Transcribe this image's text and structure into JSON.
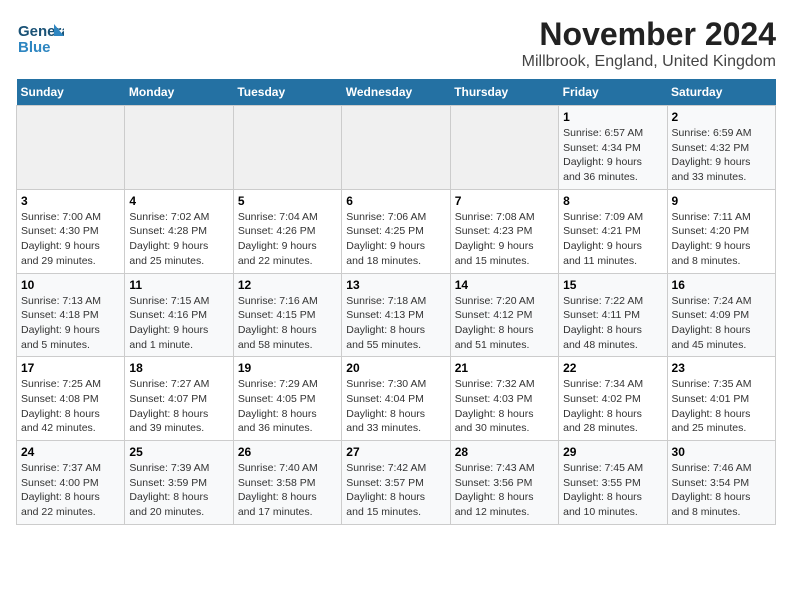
{
  "header": {
    "logo_general": "General",
    "logo_blue": "Blue",
    "title": "November 2024",
    "subtitle": "Millbrook, England, United Kingdom"
  },
  "days_of_week": [
    "Sunday",
    "Monday",
    "Tuesday",
    "Wednesday",
    "Thursday",
    "Friday",
    "Saturday"
  ],
  "weeks": [
    [
      {
        "day": "",
        "info": ""
      },
      {
        "day": "",
        "info": ""
      },
      {
        "day": "",
        "info": ""
      },
      {
        "day": "",
        "info": ""
      },
      {
        "day": "",
        "info": ""
      },
      {
        "day": "1",
        "info": "Sunrise: 6:57 AM\nSunset: 4:34 PM\nDaylight: 9 hours\nand 36 minutes."
      },
      {
        "day": "2",
        "info": "Sunrise: 6:59 AM\nSunset: 4:32 PM\nDaylight: 9 hours\nand 33 minutes."
      }
    ],
    [
      {
        "day": "3",
        "info": "Sunrise: 7:00 AM\nSunset: 4:30 PM\nDaylight: 9 hours\nand 29 minutes."
      },
      {
        "day": "4",
        "info": "Sunrise: 7:02 AM\nSunset: 4:28 PM\nDaylight: 9 hours\nand 25 minutes."
      },
      {
        "day": "5",
        "info": "Sunrise: 7:04 AM\nSunset: 4:26 PM\nDaylight: 9 hours\nand 22 minutes."
      },
      {
        "day": "6",
        "info": "Sunrise: 7:06 AM\nSunset: 4:25 PM\nDaylight: 9 hours\nand 18 minutes."
      },
      {
        "day": "7",
        "info": "Sunrise: 7:08 AM\nSunset: 4:23 PM\nDaylight: 9 hours\nand 15 minutes."
      },
      {
        "day": "8",
        "info": "Sunrise: 7:09 AM\nSunset: 4:21 PM\nDaylight: 9 hours\nand 11 minutes."
      },
      {
        "day": "9",
        "info": "Sunrise: 7:11 AM\nSunset: 4:20 PM\nDaylight: 9 hours\nand 8 minutes."
      }
    ],
    [
      {
        "day": "10",
        "info": "Sunrise: 7:13 AM\nSunset: 4:18 PM\nDaylight: 9 hours\nand 5 minutes."
      },
      {
        "day": "11",
        "info": "Sunrise: 7:15 AM\nSunset: 4:16 PM\nDaylight: 9 hours\nand 1 minute."
      },
      {
        "day": "12",
        "info": "Sunrise: 7:16 AM\nSunset: 4:15 PM\nDaylight: 8 hours\nand 58 minutes."
      },
      {
        "day": "13",
        "info": "Sunrise: 7:18 AM\nSunset: 4:13 PM\nDaylight: 8 hours\nand 55 minutes."
      },
      {
        "day": "14",
        "info": "Sunrise: 7:20 AM\nSunset: 4:12 PM\nDaylight: 8 hours\nand 51 minutes."
      },
      {
        "day": "15",
        "info": "Sunrise: 7:22 AM\nSunset: 4:11 PM\nDaylight: 8 hours\nand 48 minutes."
      },
      {
        "day": "16",
        "info": "Sunrise: 7:24 AM\nSunset: 4:09 PM\nDaylight: 8 hours\nand 45 minutes."
      }
    ],
    [
      {
        "day": "17",
        "info": "Sunrise: 7:25 AM\nSunset: 4:08 PM\nDaylight: 8 hours\nand 42 minutes."
      },
      {
        "day": "18",
        "info": "Sunrise: 7:27 AM\nSunset: 4:07 PM\nDaylight: 8 hours\nand 39 minutes."
      },
      {
        "day": "19",
        "info": "Sunrise: 7:29 AM\nSunset: 4:05 PM\nDaylight: 8 hours\nand 36 minutes."
      },
      {
        "day": "20",
        "info": "Sunrise: 7:30 AM\nSunset: 4:04 PM\nDaylight: 8 hours\nand 33 minutes."
      },
      {
        "day": "21",
        "info": "Sunrise: 7:32 AM\nSunset: 4:03 PM\nDaylight: 8 hours\nand 30 minutes."
      },
      {
        "day": "22",
        "info": "Sunrise: 7:34 AM\nSunset: 4:02 PM\nDaylight: 8 hours\nand 28 minutes."
      },
      {
        "day": "23",
        "info": "Sunrise: 7:35 AM\nSunset: 4:01 PM\nDaylight: 8 hours\nand 25 minutes."
      }
    ],
    [
      {
        "day": "24",
        "info": "Sunrise: 7:37 AM\nSunset: 4:00 PM\nDaylight: 8 hours\nand 22 minutes."
      },
      {
        "day": "25",
        "info": "Sunrise: 7:39 AM\nSunset: 3:59 PM\nDaylight: 8 hours\nand 20 minutes."
      },
      {
        "day": "26",
        "info": "Sunrise: 7:40 AM\nSunset: 3:58 PM\nDaylight: 8 hours\nand 17 minutes."
      },
      {
        "day": "27",
        "info": "Sunrise: 7:42 AM\nSunset: 3:57 PM\nDaylight: 8 hours\nand 15 minutes."
      },
      {
        "day": "28",
        "info": "Sunrise: 7:43 AM\nSunset: 3:56 PM\nDaylight: 8 hours\nand 12 minutes."
      },
      {
        "day": "29",
        "info": "Sunrise: 7:45 AM\nSunset: 3:55 PM\nDaylight: 8 hours\nand 10 minutes."
      },
      {
        "day": "30",
        "info": "Sunrise: 7:46 AM\nSunset: 3:54 PM\nDaylight: 8 hours\nand 8 minutes."
      }
    ]
  ]
}
